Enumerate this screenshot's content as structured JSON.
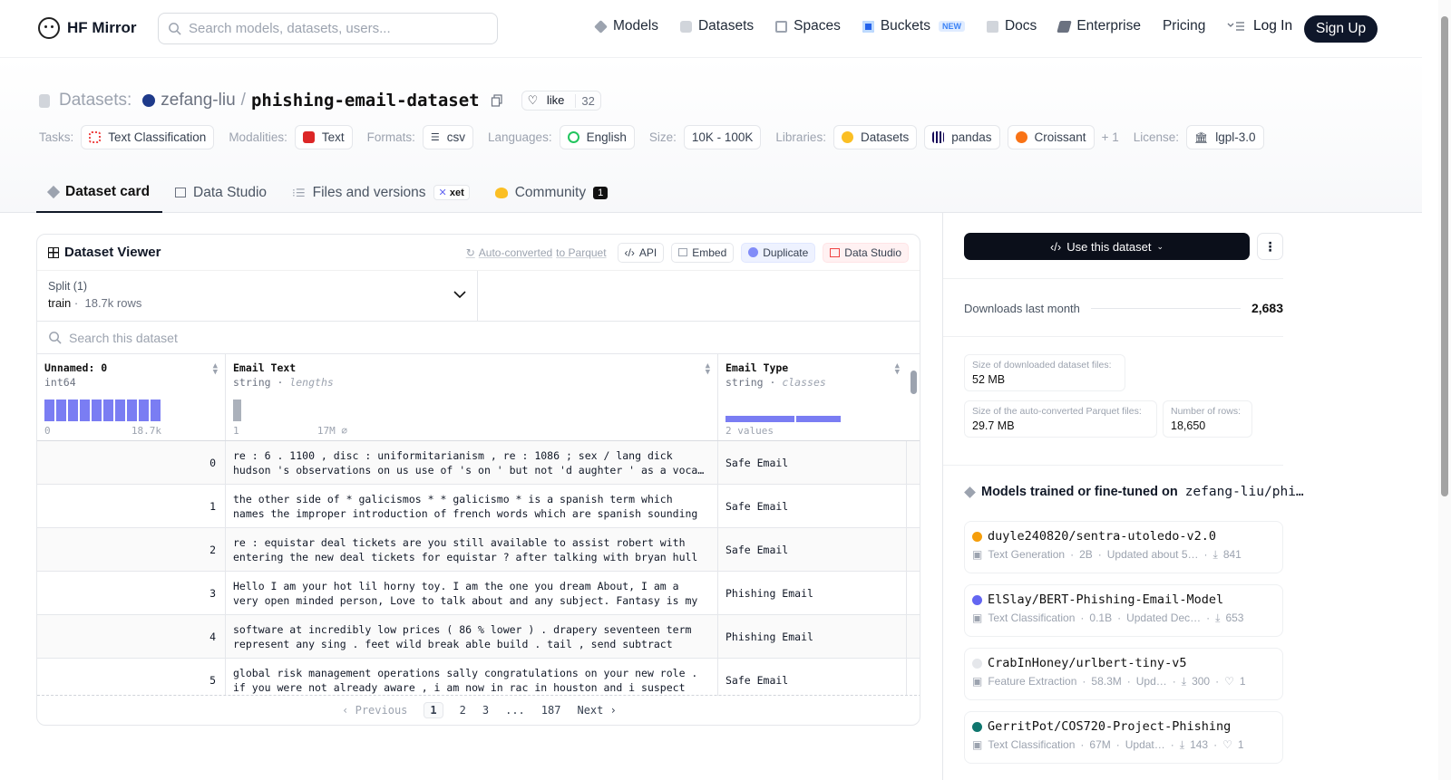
{
  "header": {
    "brand": "HF Mirror",
    "search_placeholder": "Search models, datasets, users...",
    "nav": [
      {
        "label": "Models",
        "icon": "cube-icon",
        "color": "#6b7280"
      },
      {
        "label": "Datasets",
        "icon": "database-icon",
        "color": "#9ca3af"
      },
      {
        "label": "Spaces",
        "icon": "grid-icon",
        "color": "#9ca3af"
      },
      {
        "label": "Buckets",
        "icon": "bucket-icon",
        "color": "#2563eb",
        "badge": "NEW"
      },
      {
        "label": "Docs",
        "icon": "book-icon",
        "color": "#9ca3af"
      },
      {
        "label": "Enterprise",
        "icon": "enterprise-icon",
        "color": "#6b7280"
      },
      {
        "label": "Pricing"
      }
    ],
    "login": "Log In",
    "signup": "Sign Up"
  },
  "repo": {
    "kind": "Datasets:",
    "owner": "zefang-liu",
    "name": "phishing-email-dataset",
    "like_label": "like",
    "likes": "32"
  },
  "tags": {
    "tasks_label": "Tasks:",
    "task": "Text Classification",
    "modalities_label": "Modalities:",
    "modality": "Text",
    "formats_label": "Formats:",
    "format": "csv",
    "languages_label": "Languages:",
    "language": "English",
    "size_label": "Size:",
    "size": "10K - 100K",
    "libraries_label": "Libraries:",
    "lib1": "Datasets",
    "lib2": "pandas",
    "lib3": "Croissant",
    "more": "+ 1",
    "license_label": "License:",
    "license": "lgpl-3.0"
  },
  "tabs": {
    "card": "Dataset card",
    "studio": "Data Studio",
    "files": "Files and versions",
    "xet": "xet",
    "community": "Community",
    "community_count": "1"
  },
  "viewer": {
    "title": "Dataset Viewer",
    "autoconv": "Auto-converted",
    "autoconv_rest": "to Parquet",
    "api": "API",
    "embed": "Embed",
    "duplicate": "Duplicate",
    "studio": "Data Studio",
    "split_label": "Split (1)",
    "split_value": "train",
    "split_rows": "18.7k rows",
    "search_placeholder": "Search this dataset",
    "columns": [
      {
        "name": "Unnamed: 0",
        "type": "int64",
        "sub": "",
        "min": "0",
        "max": "18.7k"
      },
      {
        "name": "Email Text",
        "type": "string",
        "sub": "lengths",
        "min": "1",
        "max": "17M ⌀"
      },
      {
        "name": "Email Type",
        "type": "string",
        "sub": "classes",
        "min": "2 values",
        "max": ""
      }
    ],
    "rows": [
      {
        "idx": "0",
        "l1": "re : 6 . 1100 , disc : uniformitarianism , re : 1086 ; sex / lang dick",
        "l2": "hudson 's observations on us use of 's on ' but not 'd aughter ' as a vocative",
        "type": "Safe Email"
      },
      {
        "idx": "1",
        "l1": "the other side of * galicismos * * galicismo * is a spanish term which",
        "l2": "names the improper introduction of french words which are spanish sounding",
        "type": "Safe Email"
      },
      {
        "idx": "2",
        "l1": "re : equistar deal tickets are you still available to assist robert with",
        "l2": "entering the new deal tickets for equistar ? after talking with bryan hull",
        "type": "Safe Email"
      },
      {
        "idx": "3",
        "l1": "Hello I am your hot lil horny toy. I am the one you dream About, I am a",
        "l2": "very open minded person, Love to talk about and any subject. Fantasy is my",
        "type": "Phishing Email"
      },
      {
        "idx": "4",
        "l1": "software at incredibly low prices ( 86 % lower ) . drapery seventeen term",
        "l2": "represent any sing . feet wild break able build . tail , send subtract",
        "type": "Phishing Email"
      },
      {
        "idx": "5",
        "l1": "global risk management operations sally congratulations on your new role .",
        "l2": "if you were not already aware , i am now in rac in houston and i suspect",
        "type": "Safe Email"
      }
    ],
    "pager": {
      "prev": "Previous",
      "p1": "1",
      "p2": "2",
      "p3": "3",
      "dots": "...",
      "last": "187",
      "next": "Next"
    }
  },
  "sidebar": {
    "use_button": "Use this dataset",
    "downloads_label": "Downloads last month",
    "downloads": "2,683",
    "stats": [
      {
        "k": "Size of downloaded dataset files:",
        "v": "52 MB"
      },
      {
        "k": "Size of the auto-converted Parquet files:",
        "v": "29.7 MB"
      },
      {
        "k": "Number of rows:",
        "v": "18,650"
      }
    ],
    "models_title": "Models trained or fine-tuned on",
    "models_repo": "zefang-liu/phi…",
    "models": [
      {
        "name": "duyle240820/sentra-utoledo-v2.0",
        "dot": "#f59e0b",
        "task": "Text Generation",
        "params": "2B",
        "updated": "Updated about 5…",
        "downloads": "841",
        "likes": ""
      },
      {
        "name": "ElSlay/BERT-Phishing-Email-Model",
        "dot": "#6366f1",
        "task": "Text Classification",
        "params": "0.1B",
        "updated": "Updated Dec…",
        "downloads": "653",
        "likes": ""
      },
      {
        "name": "CrabInHoney/urlbert-tiny-v5",
        "dot": "#e5e7eb",
        "task": "Feature Extraction",
        "params": "58.3M",
        "updated": "Upd…",
        "downloads": "300",
        "likes": "1"
      },
      {
        "name": "GerritPot/COS720-Project-Phishing",
        "dot": "#0f766e",
        "task": "Text Classification",
        "params": "67M",
        "updated": "Updat…",
        "downloads": "143",
        "likes": "1"
      }
    ]
  }
}
